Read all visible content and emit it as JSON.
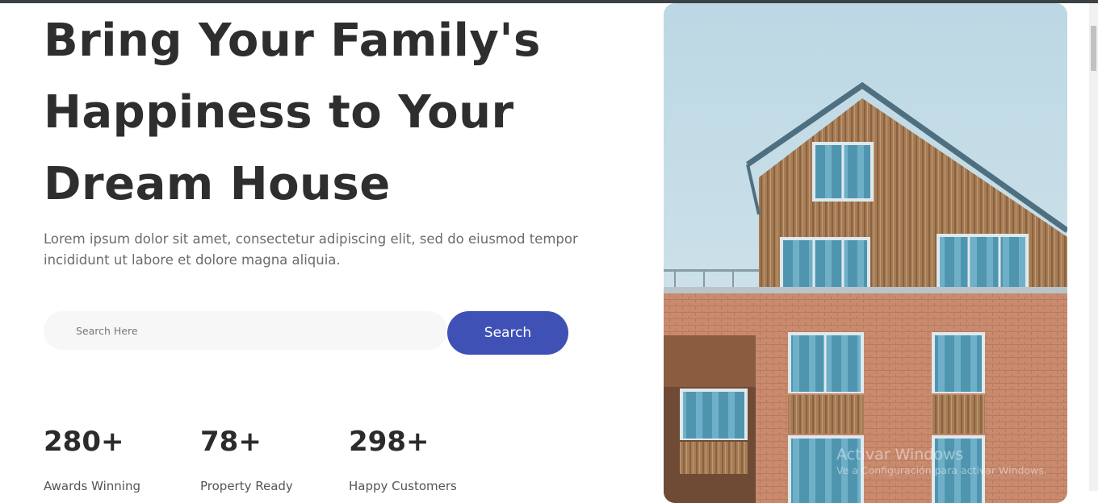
{
  "hero": {
    "title_line1": "Bring Your Family's",
    "title_line2": "Happiness to Your",
    "title_line3": "Dream House",
    "description_line1": "Lorem ipsum dolor sit amet, consectetur adipiscing elit, sed do eiusmod tempor",
    "description_line2": "incididunt ut labore et dolore magna aliquia."
  },
  "search": {
    "placeholder": "Search Here",
    "value": "",
    "button_label": "Search"
  },
  "stats": [
    {
      "number": "280+",
      "label": "Awards Winning"
    },
    {
      "number": "78+",
      "label": "Property Ready"
    },
    {
      "number": "298+",
      "label": "Happy Customers"
    }
  ],
  "watermark": {
    "line1": "Activar Windows",
    "line2": "Ve a Configuración para activar Windows."
  },
  "colors": {
    "accent": "#3f51b5",
    "title": "#2e2e2e",
    "text_muted": "#6b6b6b",
    "search_bg": "#f7f7f7"
  }
}
